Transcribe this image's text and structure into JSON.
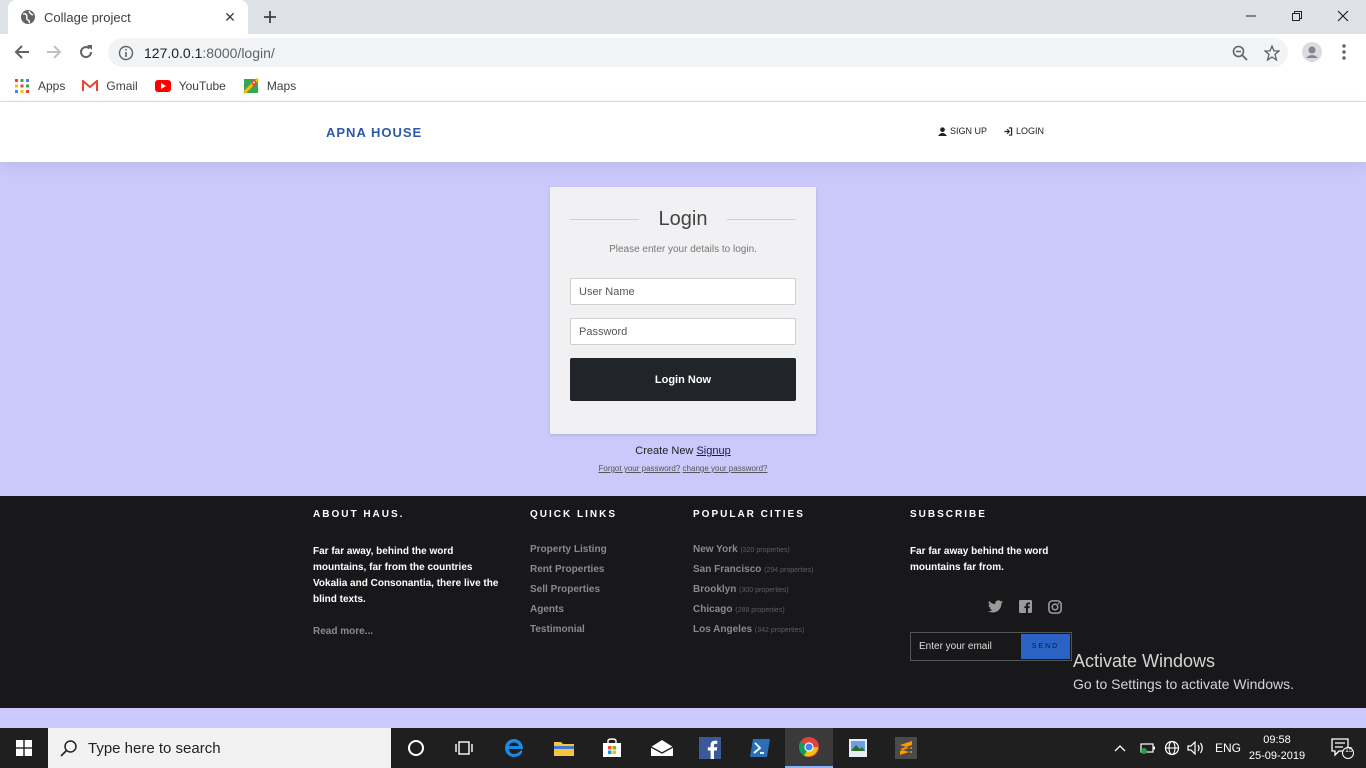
{
  "browser": {
    "tab_title": "Collage project",
    "tab_close": "✕",
    "new_tab": "+",
    "url_host": "127.0.0.1",
    "url_path": ":8000/login/",
    "bookmarks": [
      "Apps",
      "Gmail",
      "YouTube",
      "Maps"
    ]
  },
  "site": {
    "brand": "APNA HOUSE",
    "nav": {
      "signup": "SIGN UP",
      "login": "LOGIN"
    }
  },
  "login": {
    "title": "Login",
    "subtitle": "Please enter your details to login.",
    "username_placeholder": "User Name",
    "password_placeholder": "Password",
    "button": "Login Now",
    "create_prefix": "Create New ",
    "signup_link": "Signup",
    "forgot_password": "Forgot your password?",
    "change_password": "change your password?"
  },
  "footer": {
    "about": {
      "heading": "ABOUT HAUS.",
      "text": "Far far away, behind the word mountains, far from the countries Vokalia and Consonantia, there live the blind texts.",
      "read_more": "Read more..."
    },
    "quick_links": {
      "heading": "QUICK LINKS",
      "items": [
        "Property Listing",
        "Rent Properties",
        "Sell Properties",
        "Agents",
        "Testimonial"
      ]
    },
    "popular_cities": {
      "heading": "POPULAR CITIES",
      "items": [
        {
          "name": "New York",
          "count": "(320 properties)"
        },
        {
          "name": "San Francisco",
          "count": "(294 properties)"
        },
        {
          "name": "Brooklyn",
          "count": "(300 properties)"
        },
        {
          "name": "Chicago",
          "count": "(288 properties)"
        },
        {
          "name": "Los Angeles",
          "count": "(342 properties)"
        }
      ]
    },
    "subscribe": {
      "heading": "SUBSCRIBE",
      "text": "Far far away behind the word mountains far from.",
      "email_placeholder": "Enter your email",
      "send": "SEND"
    }
  },
  "watermark": {
    "line1": "Activate Windows",
    "line2": "Go to Settings to activate Windows."
  },
  "taskbar": {
    "search_placeholder": "Type here to search",
    "language": "ENG",
    "time": "09:58",
    "date": "25-09-2019",
    "notifications": "15"
  }
}
